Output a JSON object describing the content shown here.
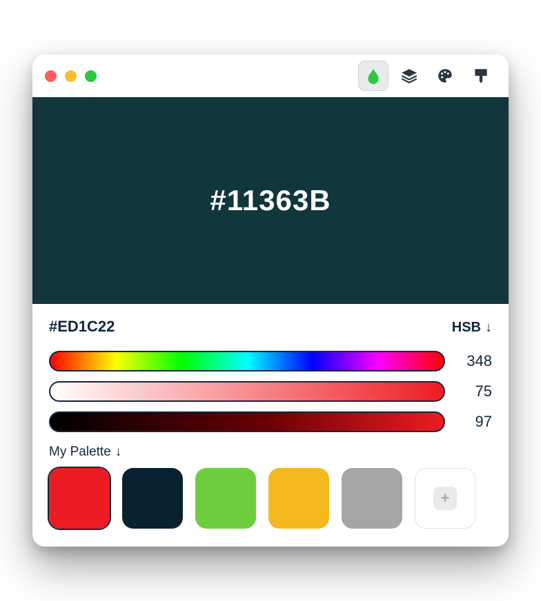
{
  "toolbar": {
    "active_tool": "picker",
    "tools": [
      "picker-icon",
      "layers-icon",
      "palette-icon",
      "brush-icon"
    ],
    "accent": "#2bc840"
  },
  "preview": {
    "hex_display": "#11363B",
    "bg": "#11363B"
  },
  "selected": {
    "hex": "#ED1C22"
  },
  "mode": {
    "label": "HSB"
  },
  "sliders": {
    "hue_value": "348",
    "sat_value": "75",
    "bri_value": "97",
    "sat_stop": "#ED1C22",
    "bri_mid": "#6b0003",
    "bri_end": "#ED1C22"
  },
  "palette": {
    "label": "My Palette",
    "swatches": [
      {
        "color": "#ED1C22",
        "selected": true
      },
      {
        "color": "#0a2230",
        "selected": false
      },
      {
        "color": "#6ecd3e",
        "selected": false
      },
      {
        "color": "#f4b91d",
        "selected": false
      },
      {
        "color": "#a5a5a5",
        "selected": false
      }
    ],
    "add_label": "+"
  }
}
